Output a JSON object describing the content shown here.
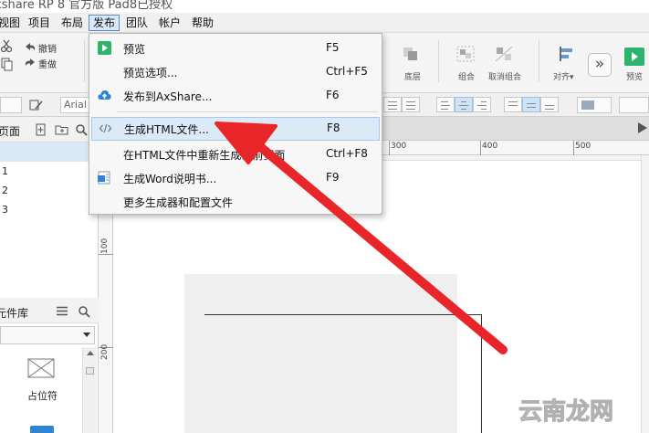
{
  "window": {
    "title": "xshare RP 8 官方版 Pad8已授权"
  },
  "menubar": {
    "items": [
      {
        "label": "视图"
      },
      {
        "label": "项目"
      },
      {
        "label": "布局"
      },
      {
        "label": "发布"
      },
      {
        "label": "团队"
      },
      {
        "label": "帐户"
      },
      {
        "label": "帮助"
      }
    ]
  },
  "toolbar": {
    "undo": "撤销",
    "redo": "重做",
    "bottom_layer": "底层",
    "group": "组合",
    "ungroup": "取消组合",
    "align": "对齐▾",
    "preview": "预览",
    "more": "»"
  },
  "formatbar": {
    "font": "Arial"
  },
  "pages_panel": {
    "title": "页面",
    "pages": [
      "1",
      "2",
      "3"
    ]
  },
  "library_panel": {
    "title": "元件库",
    "item_label": "占位符"
  },
  "rulers": {
    "h_ticks": [
      "300",
      "400",
      "500"
    ],
    "v_ticks": [
      "100",
      "200"
    ]
  },
  "publish_menu": {
    "items": [
      {
        "label": "预览",
        "shortcut": "F5"
      },
      {
        "label": "预览选项...",
        "shortcut": "Ctrl+F5"
      },
      {
        "label": "发布到AxShare...",
        "shortcut": "F6"
      },
      {
        "label": "生成HTML文件...",
        "shortcut": "F8"
      },
      {
        "label": "在HTML文件中重新生成当前页面",
        "shortcut": "Ctrl+F8"
      },
      {
        "label": "生成Word说明书...",
        "shortcut": "F9"
      },
      {
        "label": "更多生成器和配置文件",
        "shortcut": ""
      }
    ]
  },
  "watermark": {
    "text": "云南龙网"
  },
  "colors": {
    "accent": "#2e84d6",
    "menu_highlight": "#dce9f7",
    "arrow": "#e8262a",
    "preview_green": "#2db36b"
  }
}
